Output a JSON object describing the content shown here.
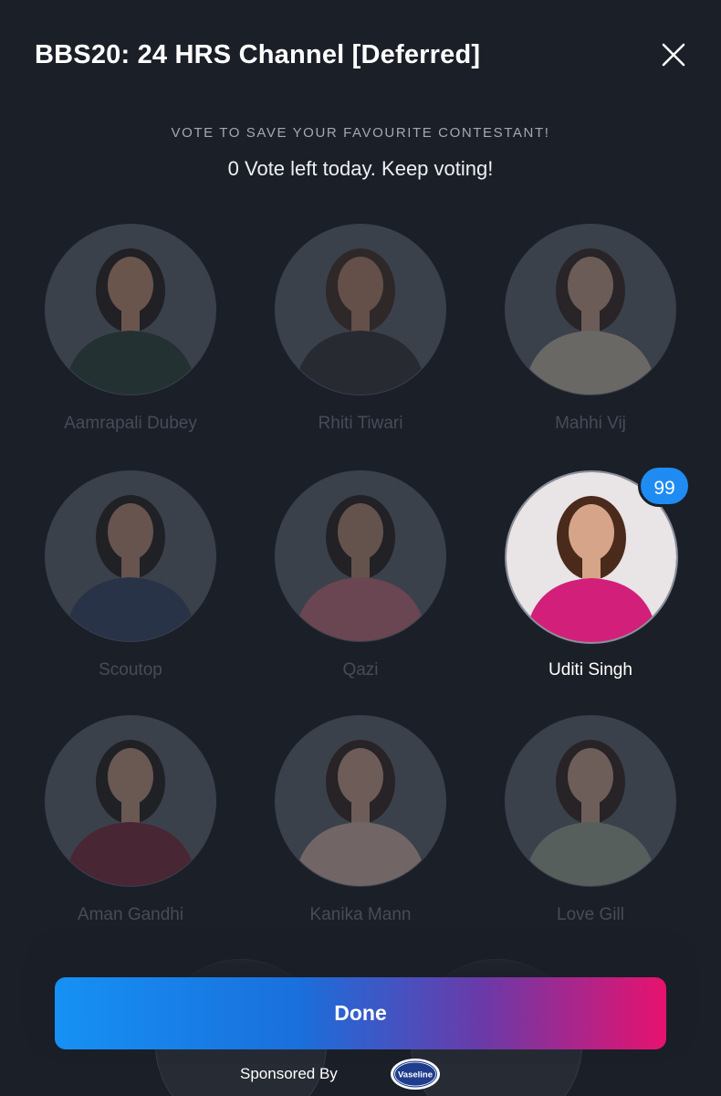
{
  "header": {
    "title": "BBS20: 24 HRS Channel [Deferred]",
    "close_icon": "close-icon"
  },
  "vote": {
    "subtitle": "VOTE TO SAVE YOUR FAVOURITE CONTESTANT!",
    "votes_left": "0 Vote left today. Keep voting!"
  },
  "contestants": [
    {
      "name": "Aamrapali Dubey",
      "selected": false,
      "outfit": "#1f3a30",
      "skin": "#c98f6e",
      "hair": "#1a1210"
    },
    {
      "name": "Rhiti Tiwari",
      "selected": false,
      "outfit": "#2a2a2a",
      "skin": "#b98264",
      "hair": "#3a2418"
    },
    {
      "name": "Mahhi Vij",
      "selected": false,
      "outfit": "#c8bca8",
      "skin": "#caa088",
      "hair": "#2c1c14"
    },
    {
      "name": "Scoutop",
      "selected": false,
      "outfit": "#2c3f60",
      "skin": "#c08e70",
      "hair": "#1a1410"
    },
    {
      "name": "Qazi",
      "selected": false,
      "outfit": "#c96a7a",
      "skin": "#b88a6c",
      "hair": "#1c1512"
    },
    {
      "name": "Uditi Singh",
      "selected": true,
      "votes": "99",
      "outfit": "#d21f7a",
      "skin": "#d6a488",
      "hair": "#4a2a1a"
    },
    {
      "name": "Aman Gandhi",
      "selected": false,
      "outfit": "#7a2030",
      "skin": "#c8967a",
      "hair": "#1a1410"
    },
    {
      "name": "Kanika Mann",
      "selected": false,
      "outfit": "#d9b8a8",
      "skin": "#cfa088",
      "hair": "#2a1a12"
    },
    {
      "name": "Love Gill",
      "selected": false,
      "outfit": "#9aa890",
      "skin": "#d0a48a",
      "hair": "#2a1a14"
    }
  ],
  "footer": {
    "done_label": "Done",
    "sponsored_by": "Sponsored By",
    "sponsor_logo_text": "Vaseline"
  },
  "colors": {
    "background": "#1b1f27",
    "badge": "#1e8cf2",
    "button_gradient_start": "#1691f4",
    "button_gradient_end": "#e8126e"
  }
}
